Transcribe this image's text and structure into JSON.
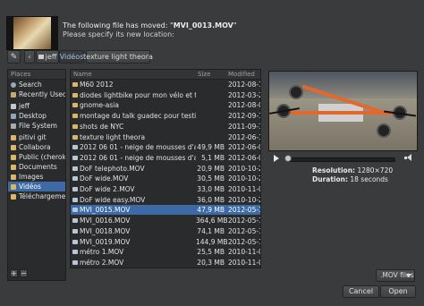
{
  "header": {
    "message_prefix": "The following file has moved: \"",
    "filename": "MVI_0013.MOV",
    "message_suffix": "\"",
    "message_line2": "Please specify its new location:"
  },
  "pathbar": {
    "segments": [
      "jeff",
      "Vidéos",
      "texture light theora"
    ],
    "active_index": 1
  },
  "places": {
    "header": "Places",
    "items": [
      {
        "label": "Search",
        "icon": "search-icon"
      },
      {
        "label": "Recently Used",
        "icon": "recent-icon"
      },
      {
        "label": "jeff",
        "icon": "home-icon"
      },
      {
        "label": "Desktop",
        "icon": "desktop-icon"
      },
      {
        "label": "File System",
        "icon": "drive-icon"
      },
      {
        "label": "pitivi git",
        "icon": "folder-icon"
      },
      {
        "label": "Collabora",
        "icon": "folder-icon"
      },
      {
        "label": "Public (cherokee)",
        "icon": "folder-icon"
      },
      {
        "label": "Documents",
        "icon": "folder-icon"
      },
      {
        "label": "Images",
        "icon": "folder-icon"
      },
      {
        "label": "Vidéos",
        "icon": "folder-icon"
      },
      {
        "label": "Téléchargements",
        "icon": "folder-icon"
      }
    ],
    "selected_index": 10,
    "add_label": "+",
    "remove_label": "−"
  },
  "files": {
    "columns": {
      "name": "Name",
      "size": "Size",
      "modified": "Modified"
    },
    "rows": [
      {
        "name": "M60 2012",
        "size": "",
        "modified": "2012-08-17",
        "type": "folder"
      },
      {
        "name": "diodes lightbike pour mon vélo et test ...",
        "size": "",
        "modified": "2012-03-23",
        "type": "folder"
      },
      {
        "name": "gnome-asia",
        "size": "",
        "modified": "2012-08-09",
        "type": "folder"
      },
      {
        "name": "montage du talk guadec pour testing",
        "size": "",
        "modified": "2012-09-18",
        "type": "folder"
      },
      {
        "name": "shots de NYC",
        "size": "",
        "modified": "2011-09-11",
        "type": "folder"
      },
      {
        "name": "texture light theora",
        "size": "",
        "modified": "2012-06-13",
        "type": "folder"
      },
      {
        "name": "2012 06 01 - neige de mousses d'arbre...",
        "size": "49,9 MB",
        "modified": "2012-06-01",
        "type": "video"
      },
      {
        "name": "2012 06 01 - neige de mousses d'arbre...",
        "size": "5,1 MB",
        "modified": "2012-06-01",
        "type": "video"
      },
      {
        "name": "DoF telephoto.MOV",
        "size": "20,9 MB",
        "modified": "2010-10-21",
        "type": "video"
      },
      {
        "name": "DoF wide.MOV",
        "size": "30,5 MB",
        "modified": "2010-10-21",
        "type": "video"
      },
      {
        "name": "DoF wide 2.MOV",
        "size": "33,0 MB",
        "modified": "2010-11-02",
        "type": "video"
      },
      {
        "name": "DoF wide easy.MOV",
        "size": "36,0 MB",
        "modified": "2010-10-21",
        "type": "video"
      },
      {
        "name": "MVI_0015.MOV",
        "size": "47,9 MB",
        "modified": "2012-05-13",
        "type": "video"
      },
      {
        "name": "MVI_0016.MOV",
        "size": "364,6 MB",
        "modified": "2012-05-13",
        "type": "video"
      },
      {
        "name": "MVI_0018.MOV",
        "size": "74,1 MB",
        "modified": "2012-05-13",
        "type": "video"
      },
      {
        "name": "MVI_0019.MOV",
        "size": "144,9 MB",
        "modified": "2012-05-13",
        "type": "video"
      },
      {
        "name": "métro 1.MOV",
        "size": "25,5 MB",
        "modified": "2010-11-02",
        "type": "video"
      },
      {
        "name": "métro 2.MOV",
        "size": "20,3 MB",
        "modified": "2010-11-02",
        "type": "video"
      }
    ],
    "selected_index": 12
  },
  "preview": {
    "resolution_label": "Resolution:",
    "resolution_value": "1280×720",
    "duration_label": "Duration:",
    "duration_value": "18 seconds",
    "position_fraction": 0.0
  },
  "footer": {
    "filter": ".MOV files",
    "cancel": "Cancel",
    "open": "Open"
  },
  "colors": {
    "background": "#3a3b3c",
    "selection": "#3d6aa4",
    "active_path": "#9ec3ee"
  }
}
